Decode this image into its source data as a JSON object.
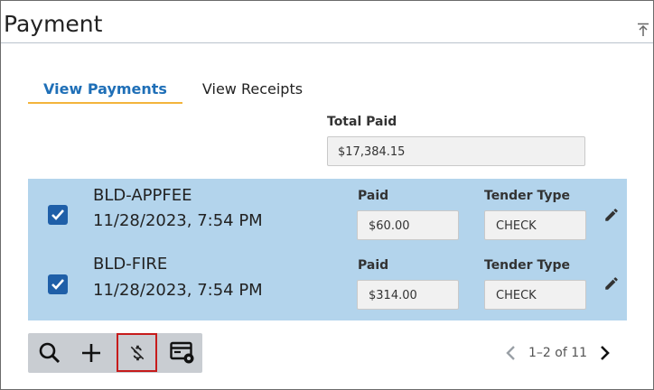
{
  "header": {
    "title": "Payment",
    "collapse_icon": "collapse-up-icon"
  },
  "tabs": [
    {
      "label": "View Payments",
      "active": true
    },
    {
      "label": "View Receipts",
      "active": false
    }
  ],
  "total": {
    "label": "Total Paid",
    "value": "$17,384.15"
  },
  "payments": [
    {
      "checked": true,
      "code": "BLD-APPFEE",
      "datetime": "11/28/2023, 7:54 PM",
      "paid_label": "Paid",
      "paid_value": "$60.00",
      "tender_label": "Tender Type",
      "tender_value": "CHECK"
    },
    {
      "checked": true,
      "code": "BLD-FIRE",
      "datetime": "11/28/2023, 7:54 PM",
      "paid_label": "Paid",
      "paid_value": "$314.00",
      "tender_label": "Tender Type",
      "tender_value": "CHECK"
    }
  ],
  "toolbar": {
    "items": [
      {
        "icon": "search-icon"
      },
      {
        "icon": "add-icon"
      },
      {
        "icon": "no-money-icon",
        "selected": true
      },
      {
        "icon": "card-settings-icon"
      }
    ]
  },
  "pagination": {
    "text": "1–2 of 11"
  },
  "colors": {
    "accent_blue": "#1f6fb7",
    "tab_underline": "#f3b43c",
    "row_highlight": "#b3d4ec",
    "checkbox": "#1f5fa8",
    "selected_outline": "#c61b1b"
  }
}
